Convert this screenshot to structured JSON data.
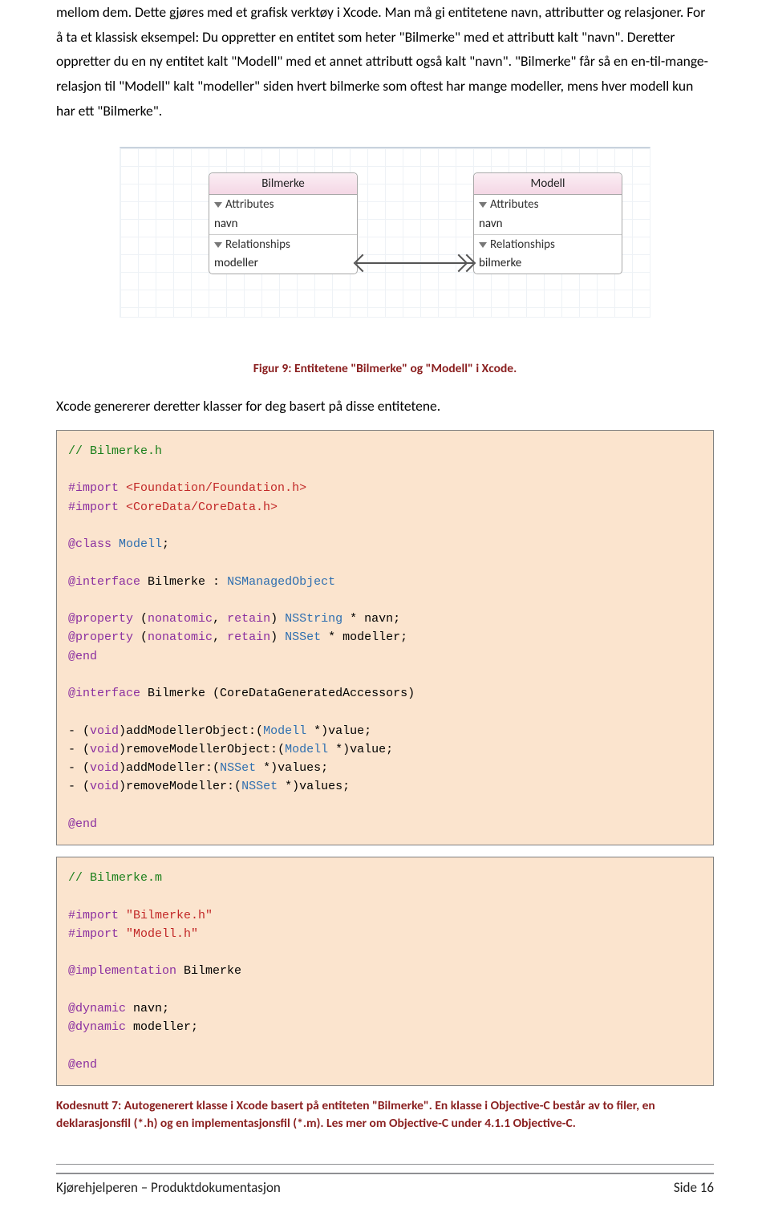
{
  "paragraph": "mellom dem. Dette gjøres med et grafisk verktøy i Xcode. Man må gi entitetene navn, attributter og relasjoner. For å ta et klassisk eksempel: Du oppretter en entitet som heter \"Bilmerke\" med et attributt kalt \"navn\". Deretter oppretter du en ny entitet kalt \"Modell\" med et annet attributt også kalt \"navn\". \"Bilmerke\" får så en en-til-mange-relasjon til \"Modell\" kalt \"modeller\" siden hvert bilmerke som oftest har mange modeller, mens hver modell kun har ett \"Bilmerke\".",
  "diagram": {
    "left": {
      "title": "Bilmerke",
      "attributes_label": "Attributes",
      "attribute": "navn",
      "relationships_label": "Relationships",
      "relationship": "modeller"
    },
    "right": {
      "title": "Modell",
      "attributes_label": "Attributes",
      "attribute": "navn",
      "relationships_label": "Relationships",
      "relationship": "bilmerke"
    }
  },
  "figure_caption": "Figur 9: Entitetene \"Bilmerke\" og \"Modell\" i Xcode.",
  "after_figure": "Xcode genererer deretter klasser for deg basert på disse entitetene.",
  "code1": {
    "l1": "// Bilmerke.h",
    "l2a": "#import",
    "l2b": "<Foundation/Foundation.h>",
    "l3a": "#import",
    "l3b": "<CoreData/CoreData.h>",
    "l4a": "@class",
    "l4b": "Modell",
    "l5a": "@interface",
    "l5b": "Bilmerke :",
    "l5c": "NSManagedObject",
    "l6a": "@property",
    "l6b": "(",
    "l6c": "nonatomic",
    "l6d": ",",
    "l6e": "retain",
    "l6f": ")",
    "l6g": "NSString",
    "l6h": "* navn;",
    "l7a": "@property",
    "l7b": "(",
    "l7c": "nonatomic",
    "l7d": ",",
    "l7e": "retain",
    "l7f": ")",
    "l7g": "NSSet",
    "l7h": "* modeller;",
    "l8": "@end",
    "l9a": "@interface",
    "l9b": "Bilmerke (CoreDataGeneratedAccessors)",
    "l10a": "- (",
    "l10b": "void",
    "l10c": ")addModellerObject:(",
    "l10d": "Modell",
    "l10e": " *)value;",
    "l11a": "- (",
    "l11b": "void",
    "l11c": ")removeModellerObject:(",
    "l11d": "Modell",
    "l11e": " *)value;",
    "l12a": "- (",
    "l12b": "void",
    "l12c": ")addModeller:(",
    "l12d": "NSSet",
    "l12e": " *)values;",
    "l13a": "- (",
    "l13b": "void",
    "l13c": ")removeModeller:(",
    "l13d": "NSSet",
    "l13e": " *)values;",
    "l14": "@end"
  },
  "code2": {
    "l1": "// Bilmerke.m",
    "l2a": "#import",
    "l2b": "\"Bilmerke.h\"",
    "l3a": "#import",
    "l3b": "\"Modell.h\"",
    "l4a": "@implementation",
    "l4b": "Bilmerke",
    "l5a": "@dynamic",
    "l5b": "navn;",
    "l6a": "@dynamic",
    "l6b": "modeller;",
    "l7": "@end"
  },
  "snippet_caption": "Kodesnutt 7: Autogenerert klasse i Xcode basert på entiteten \"Bilmerke\". En klasse i Objective-C består av to filer, en deklarasjonsfil (*.h) og en implementasjonsfil (*.m). Les mer om Objective-C under 4.1.1 Objective-C.",
  "footer": {
    "left": "Kjørehjelperen – Produktdokumentasjon",
    "right": "Side 16"
  }
}
